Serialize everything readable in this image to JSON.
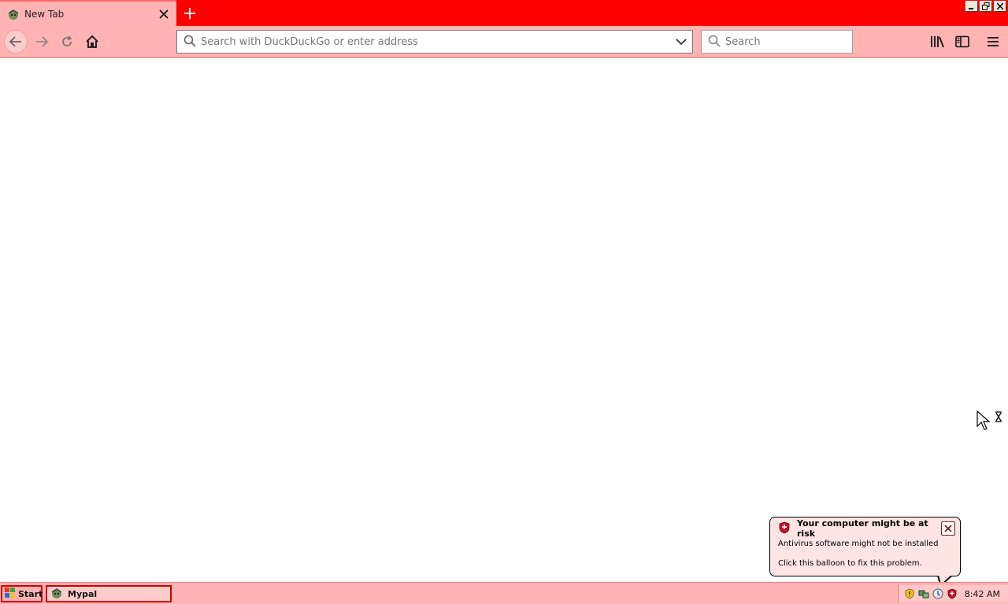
{
  "tab": {
    "title": "New Tab",
    "favicon": "browser-logo-icon"
  },
  "window_controls": [
    "minimize-icon",
    "restore-icon",
    "close-icon"
  ],
  "toolbar": {
    "url_placeholder": "Search with DuckDuckGo or enter address",
    "search_placeholder": "Search"
  },
  "notification": {
    "title": "Your computer might be at risk",
    "line1": "Antivirus software might not be installed",
    "line2": "Click this balloon to fix this problem."
  },
  "taskbar": {
    "start_label": "Start",
    "task_label": "Mypal",
    "clock": "8:42 AM"
  },
  "colors": {
    "tabbar": "#ff0000",
    "toolbar": "#ffb3b3",
    "taskbar": "#ffb3b3"
  }
}
